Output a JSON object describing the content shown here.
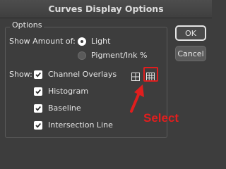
{
  "window": {
    "title": "Curves Display Options"
  },
  "options_group": {
    "label": "Options"
  },
  "show_amount": {
    "label": "Show Amount of:",
    "options": [
      {
        "label": "Light",
        "selected": true
      },
      {
        "label": "Pigment/Ink %",
        "selected": false
      }
    ]
  },
  "show": {
    "label": "Show:",
    "items": [
      {
        "label": "Channel Overlays",
        "checked": true
      },
      {
        "label": "Histogram",
        "checked": true
      },
      {
        "label": "Baseline",
        "checked": true
      },
      {
        "label": "Intersection Line",
        "checked": true
      }
    ],
    "grid_options": [
      {
        "icon": "simple-grid-icon",
        "selected": false
      },
      {
        "icon": "detailed-grid-icon",
        "selected": true
      }
    ]
  },
  "buttons": {
    "ok": "OK",
    "cancel": "Cancel"
  },
  "annotation": {
    "text": "Select",
    "color": "#e01e1e"
  }
}
